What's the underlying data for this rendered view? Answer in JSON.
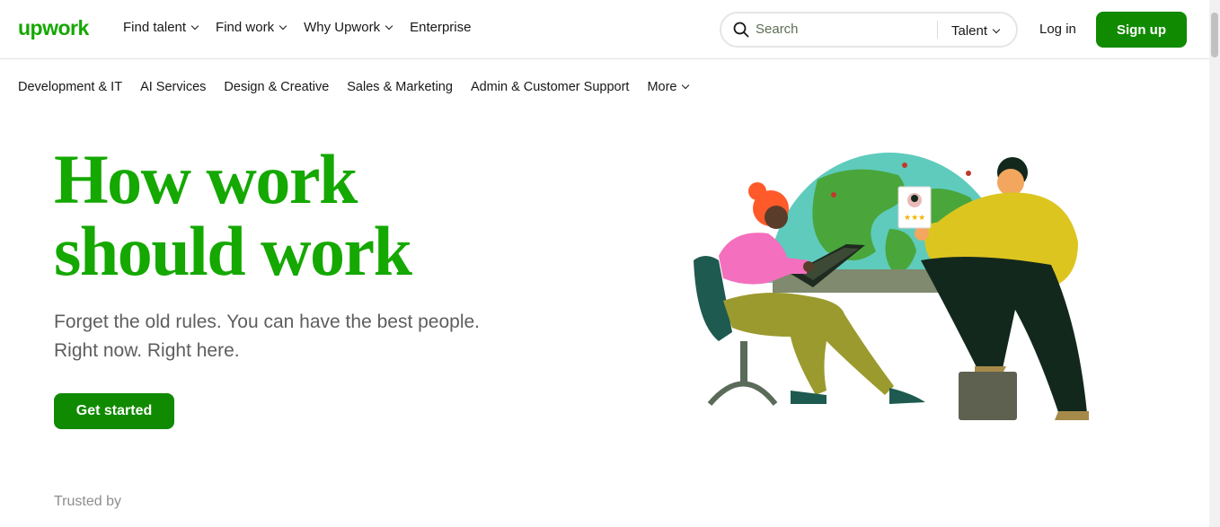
{
  "brand": {
    "logo_text": "upwork",
    "accent": "#14a800",
    "button_green": "#108a00"
  },
  "topnav": {
    "items": [
      {
        "label": "Find talent",
        "has_dropdown": true
      },
      {
        "label": "Find work",
        "has_dropdown": true
      },
      {
        "label": "Why Upwork",
        "has_dropdown": true
      },
      {
        "label": "Enterprise",
        "has_dropdown": false
      }
    ],
    "search": {
      "placeholder": "Search",
      "scope": "Talent",
      "icon": "search-icon"
    },
    "login_label": "Log in",
    "signup_label": "Sign up"
  },
  "categories": {
    "items": [
      "Development & IT",
      "AI Services",
      "Design & Creative",
      "Sales & Marketing",
      "Admin & Customer Support"
    ],
    "more_label": "More"
  },
  "hero": {
    "title_line1": "How work",
    "title_line2": "should work",
    "subtitle_line1": "Forget the old rules. You can have the best people.",
    "subtitle_line2": "Right now. Right here.",
    "cta_label": "Get started"
  },
  "trusted_label": "Trusted by"
}
